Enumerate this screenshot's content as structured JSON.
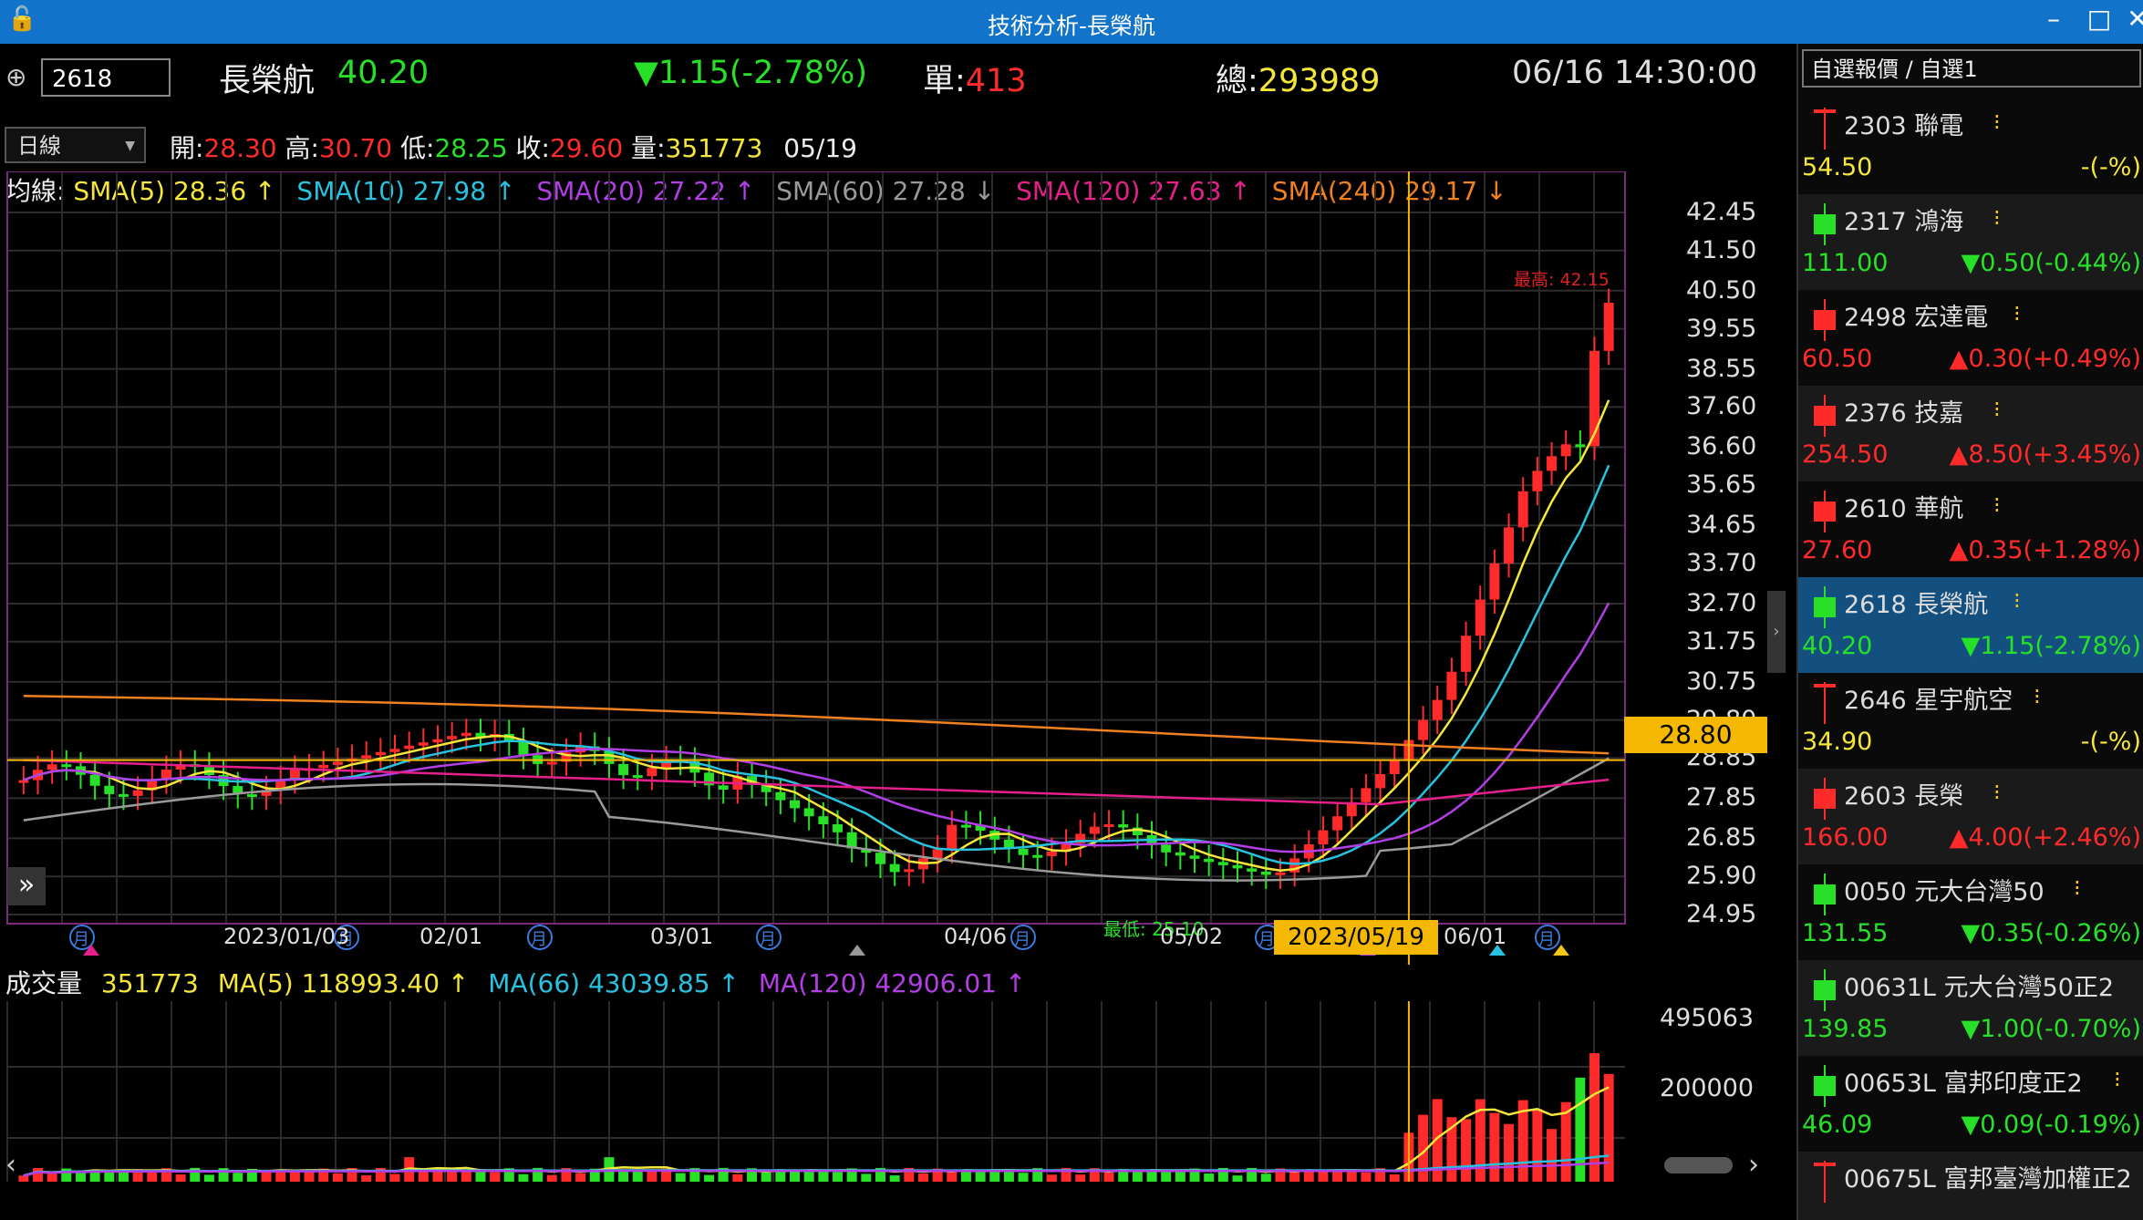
{
  "window": {
    "title": "技術分析-長榮航",
    "minimize": "–",
    "maximize": "□",
    "close": "✕"
  },
  "header": {
    "code": "2618",
    "name": "長榮航",
    "price": "40.20",
    "change": "▼1.15(-2.78%)",
    "single_label": "單:",
    "single_value": "413",
    "total_label": "總:",
    "total_value": "293989",
    "datetime": "06/16 14:30:00"
  },
  "ohlc": {
    "period": "日線",
    "open_label": "開:",
    "open": "28.30",
    "high_label": "高:",
    "high": "30.70",
    "low_label": "低:",
    "low": "28.25",
    "close_label": "收:",
    "close": "29.60",
    "vol_label": "量:",
    "vol": "351773",
    "date": "05/19"
  },
  "ma_legend": {
    "prefix": "均線:",
    "items": [
      {
        "text": "SMA(5) 28.36 ↑",
        "color": "#f5e63a"
      },
      {
        "text": "SMA(10) 27.98 ↑",
        "color": "#27c2e0"
      },
      {
        "text": "SMA(20) 27.22 ↑",
        "color": "#b23ee6"
      },
      {
        "text": "SMA(60) 27.28 ↓",
        "color": "#9a9a9a"
      },
      {
        "text": "SMA(120) 27.63 ↑",
        "color": "#e6208a"
      },
      {
        "text": "SMA(240) 29.17 ↓",
        "color": "#f08020"
      }
    ]
  },
  "chart": {
    "y_ticks": [
      "42.45",
      "41.50",
      "40.50",
      "39.55",
      "38.55",
      "37.60",
      "36.60",
      "35.65",
      "34.65",
      "33.70",
      "32.70",
      "31.75",
      "30.75",
      "29.80",
      "28.85",
      "27.85",
      "26.85",
      "25.90",
      "24.95"
    ],
    "x_ticks": [
      "2023/01/03",
      "02/01",
      "03/01",
      "04/06",
      "05/02",
      "06/01"
    ],
    "cursor_date": "2023/05/19",
    "cursor_price": "28.80",
    "high_note": "最高: 42.15",
    "low_note": "最低: 25.10",
    "month_marker": "月"
  },
  "volume": {
    "label": "成交量",
    "value": "351773",
    "ma5": "MA(5) 118993.40 ↑",
    "ma66": "MA(66) 43039.85 ↑",
    "ma120": "MA(120) 42906.01 ↑",
    "y_ticks": [
      "495063",
      "200000"
    ]
  },
  "watchlist": {
    "title": "自選報價 / 自選1",
    "items": [
      {
        "name": "2303 聯電",
        "price": "54.50",
        "change": "-(-%)",
        "dir": "flat"
      },
      {
        "name": "2317 鴻海",
        "price": "111.00",
        "change": "▼0.50(-0.44%)",
        "dir": "down"
      },
      {
        "name": "2498 宏達電",
        "price": "60.50",
        "change": "▲0.30(+0.49%)",
        "dir": "up"
      },
      {
        "name": "2376 技嘉",
        "price": "254.50",
        "change": "▲8.50(+3.45%)",
        "dir": "up"
      },
      {
        "name": "2610 華航",
        "price": "27.60",
        "change": "▲0.35(+1.28%)",
        "dir": "up"
      },
      {
        "name": "2618 長榮航",
        "price": "40.20",
        "change": "▼1.15(-2.78%)",
        "dir": "down"
      },
      {
        "name": "2646 星宇航空",
        "price": "34.90",
        "change": "-(-%)",
        "dir": "flat"
      },
      {
        "name": "2603 長榮",
        "price": "166.00",
        "change": "▲4.00(+2.46%)",
        "dir": "up"
      },
      {
        "name": "0050 元大台灣50",
        "price": "131.55",
        "change": "▼0.35(-0.26%)",
        "dir": "down"
      },
      {
        "name": "00631L 元大台灣50正2",
        "price": "139.85",
        "change": "▼1.00(-0.70%)",
        "dir": "down"
      },
      {
        "name": "00653L 富邦印度正2",
        "price": "46.09",
        "change": "▼0.09(-0.19%)",
        "dir": "down"
      },
      {
        "name": "00675L 富邦臺灣加權正2",
        "price": "",
        "change": "",
        "dir": "flat"
      }
    ]
  },
  "colors": {
    "up": "#ff2a2a",
    "down": "#27e027",
    "accent": "#f5b800",
    "title_bar": "#1173c9"
  }
}
